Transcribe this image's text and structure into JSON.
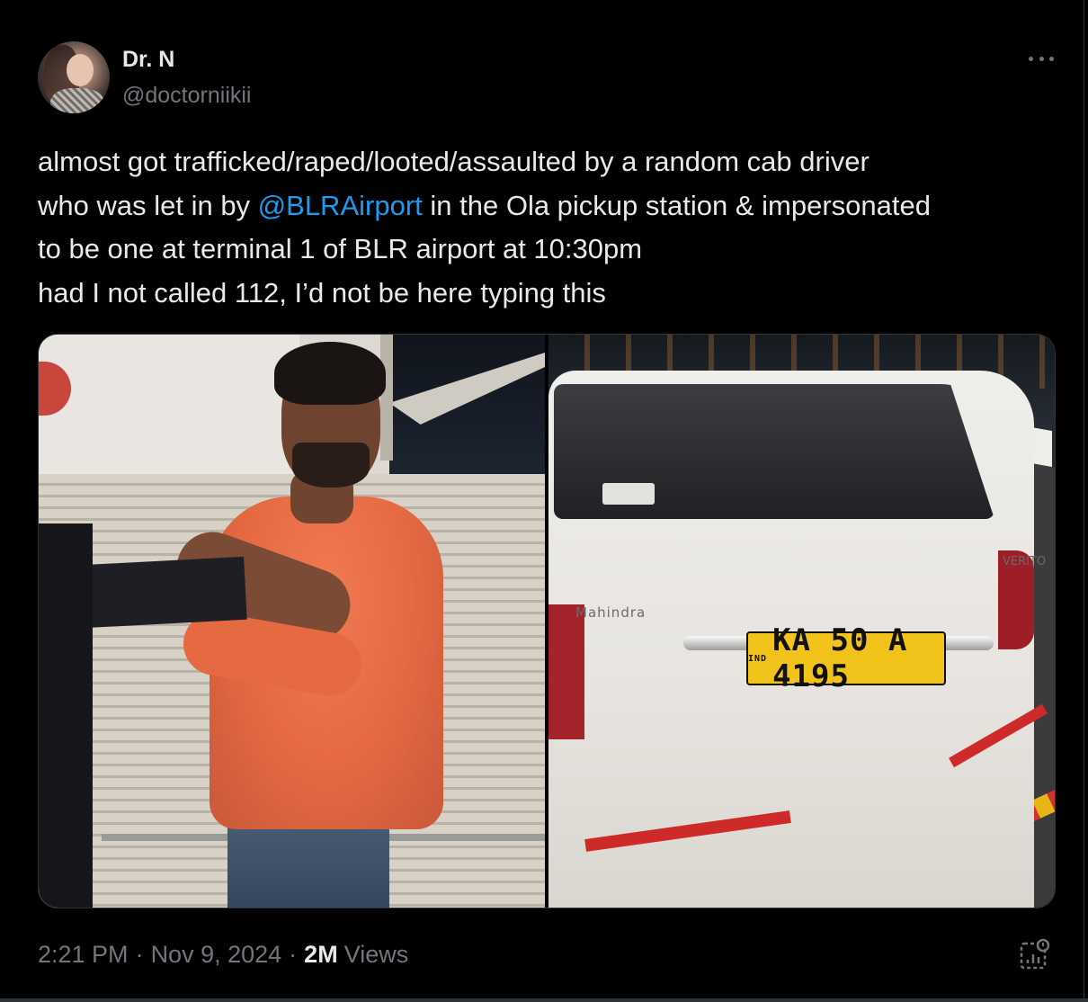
{
  "author": {
    "display_name": "Dr. N",
    "handle": "@doctorniikii",
    "avatar_icon": "profile-photo"
  },
  "tweet": {
    "text_line1": "almost got trafficked/raped/looted/assaulted by a random cab driver",
    "text_line2_before": "who was let in by ",
    "mention": "@BLRAirport",
    "text_line2_after": " in the Ola pickup station & impersonated",
    "text_line3": "to be one at terminal 1 of BLR airport at 10:30pm",
    "text_line4": "had I not called 112, I’d not be here typing this",
    "mention_color": "#1d9bf0"
  },
  "media": {
    "photo_left_desc_icon": "photo",
    "photo_right_plate_prefix": "IND",
    "photo_right_plate": "KA 50 A 4195",
    "photo_right_brand": "Mahindra",
    "photo_right_model": "VERITO"
  },
  "meta": {
    "time": "2:21 PM",
    "separator1": "·",
    "date": "Nov 9, 2024",
    "separator2": "·",
    "views_count": "2M",
    "views_label": "Views"
  },
  "icons": {
    "more": "more-horizontal-icon",
    "analytics": "analytics-icon"
  },
  "colors": {
    "background": "#000000",
    "text_primary": "#e7e9ea",
    "text_secondary": "#71767b",
    "accent": "#1d9bf0"
  }
}
